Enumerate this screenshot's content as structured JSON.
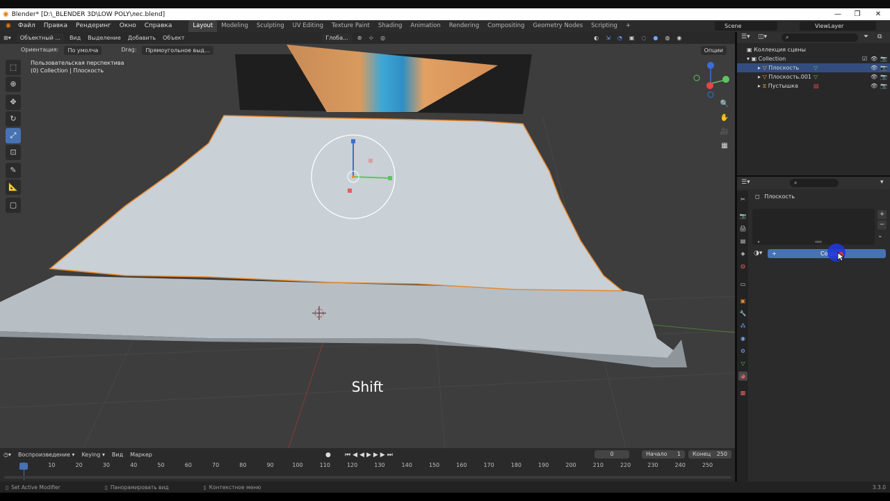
{
  "window": {
    "title": "Blender* [D:\\_BLENDER 3D\\LOW POLY\\лес.blend]",
    "minimize_icon": "minimize-icon",
    "maximize_icon": "maximize-icon",
    "close_icon": "close-icon"
  },
  "menu": [
    "Файл",
    "Правка",
    "Рендеринг",
    "Окно",
    "Справка"
  ],
  "workspaces": [
    "Layout",
    "Modeling",
    "Sculpting",
    "UV Editing",
    "Texture Paint",
    "Shading",
    "Animation",
    "Rendering",
    "Compositing",
    "Geometry Nodes",
    "Scripting"
  ],
  "workspace_add": "+",
  "scene": {
    "label": "Scene",
    "view_layer": "ViewLayer"
  },
  "viewport": {
    "mode": "Объектный ...",
    "menus": [
      "Вид",
      "Выделение",
      "Добавить",
      "Объект"
    ],
    "transform_orientation": "Глоба...",
    "options": "Опции",
    "orientation_label": "Ориентация:",
    "orientation_value": "По умолча",
    "drag_label": "Drag:",
    "drag_value": "Прямоугольное выд...",
    "info_line1": "Пользовательская перспектива",
    "info_line2": "(0) Collection | Плоскость",
    "overlay_key": "Shift"
  },
  "gizmo": {
    "z": "Z",
    "y": "Y"
  },
  "timeline": {
    "playback": "Воспроизведение",
    "keying": "Keying",
    "view": "Вид",
    "marker": "Маркер",
    "current_frame": "0",
    "start_label": "Начало",
    "start_value": "1",
    "end_label": "Конец",
    "end_value": "250",
    "ticks": [
      "0",
      "10",
      "20",
      "30",
      "40",
      "50",
      "60",
      "70",
      "80",
      "90",
      "100",
      "110",
      "120",
      "130",
      "140",
      "150",
      "160",
      "170",
      "180",
      "190",
      "200",
      "210",
      "220",
      "230",
      "240",
      "250"
    ]
  },
  "statusbar": {
    "left": "Set Active Modifier",
    "middle": "Панорамировать вид",
    "right": "Контекстное меню",
    "version": "3.3.0"
  },
  "outliner": {
    "root": "Коллекция сцены",
    "collection": "Collection",
    "items": [
      {
        "name": "Плоскость",
        "selected": true
      },
      {
        "name": "Плоскость.001",
        "selected": false
      },
      {
        "name": "Пустышка",
        "selected": false
      }
    ]
  },
  "properties": {
    "object_name": "Плоскость",
    "new_button": "Созда",
    "plus": "+"
  },
  "colors": {
    "accent": "#4772b3",
    "selection_outline": "#e8892c",
    "outliner_selected": "#334d80",
    "plane": "#c9d0d6"
  }
}
